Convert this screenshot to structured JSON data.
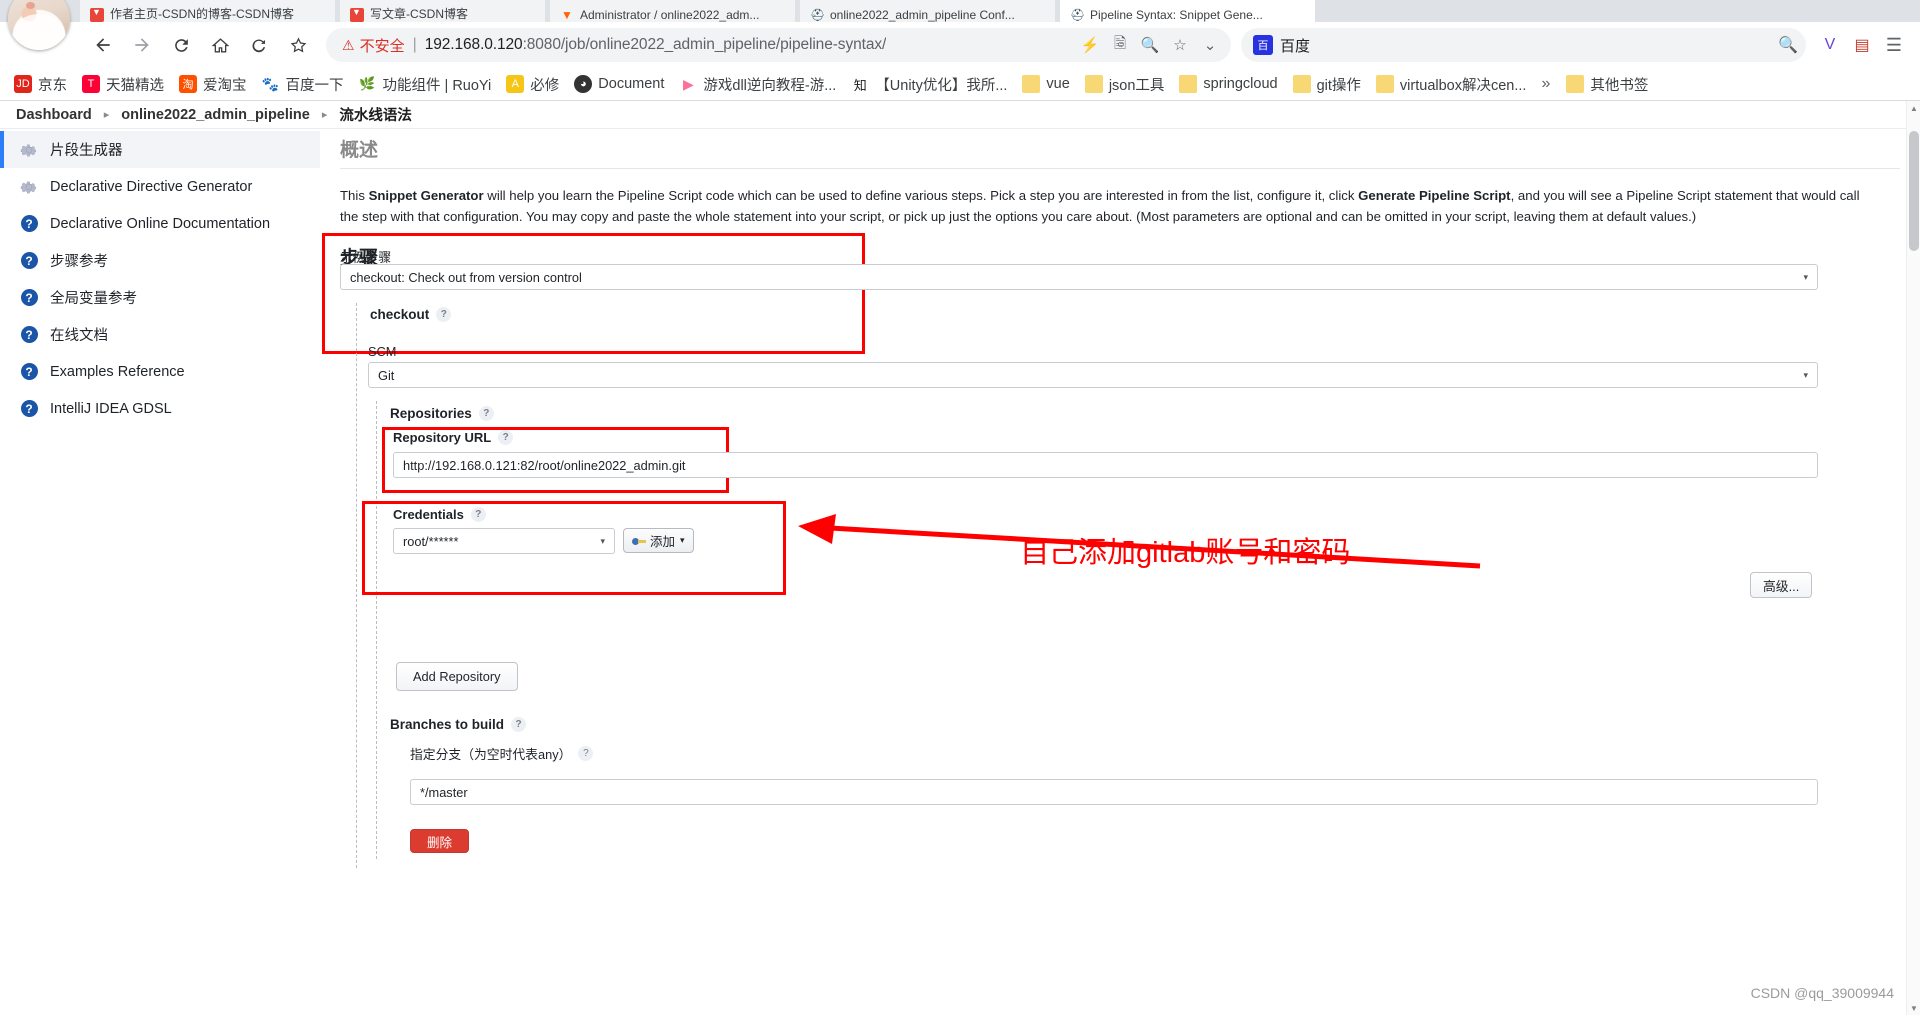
{
  "browser": {
    "tabs": [
      {
        "label": "作者主页-CSDN的博客-CSDN博客",
        "favicon": "csdn-icon",
        "active": false
      },
      {
        "label": "写文章-CSDN博客",
        "favicon": "csdn-icon",
        "active": false
      },
      {
        "label": "Administrator / online2022_adm...",
        "favicon": "gitlab-icon",
        "active": false
      },
      {
        "label": "online2022_admin_pipeline Conf...",
        "favicon": "jenkins-icon",
        "active": false
      },
      {
        "label": "Pipeline Syntax: Snippet Gene...",
        "favicon": "jenkins-icon",
        "active": true
      }
    ],
    "nav": {
      "back_icon": "back-arrow-icon",
      "forward_icon": "forward-arrow-icon",
      "reload_icon": "reload-icon",
      "home_icon": "home-icon",
      "history_icon": "history-back-icon",
      "bookmark_icon": "star-icon"
    },
    "omnibox": {
      "security_label": "不安全",
      "security_icon": "warning-triangle-icon",
      "url_host": "192.168.0.120",
      "url_path": ":8080/job/online2022_admin_pipeline/pipeline-syntax/",
      "icons": [
        "lightning-icon",
        "translate-icon",
        "zoom-icon",
        "star-outline-icon",
        "chevron-down-icon"
      ]
    },
    "search": {
      "engine_label": "百度",
      "engine_icon": "baidu-icon",
      "search_icon": "search-icon"
    },
    "right_icons": [
      "v-extension-icon",
      "pdf-extension-icon",
      "menu-icon"
    ],
    "bookmarks": [
      {
        "label": "京东",
        "icon": "jd-icon",
        "color": "#e1251b"
      },
      {
        "label": "天猫精选",
        "icon": "tmall-icon",
        "color": "#ff0036"
      },
      {
        "label": "爱淘宝",
        "icon": "taobao-icon",
        "color": "#ff5000"
      },
      {
        "label": "百度一下",
        "icon": "baidu-icon",
        "color": "#2932e1"
      },
      {
        "label": "功能组件 | RuoYi",
        "icon": "ruoyi-icon",
        "color": "#6ab04c"
      },
      {
        "label": "必修",
        "icon": "bixiu-icon",
        "color": "#f5c518"
      },
      {
        "label": "Document",
        "icon": "document-icon",
        "color": "#333333"
      },
      {
        "label": "游戏dll逆向教程-游...",
        "icon": "bilibili-icon",
        "color": "#fb7299"
      },
      {
        "label": "【Unity优化】我所...",
        "icon": "zhihu-icon",
        "color": "#0084ff"
      },
      {
        "label": "vue",
        "icon": "folder-icon",
        "color": "#f8d775"
      },
      {
        "label": "json工具",
        "icon": "folder-icon",
        "color": "#f8d775"
      },
      {
        "label": "springcloud",
        "icon": "folder-icon",
        "color": "#f8d775"
      },
      {
        "label": "git操作",
        "icon": "folder-icon",
        "color": "#f8d775"
      },
      {
        "label": "virtualbox解决cen...",
        "icon": "folder-icon",
        "color": "#f8d775"
      }
    ],
    "bookmarks_overflow": "»",
    "other_bookmarks": {
      "label": "其他书签",
      "icon": "folder-icon"
    }
  },
  "jenkins": {
    "breadcrumb": [
      {
        "label": "Dashboard"
      },
      {
        "label": "online2022_admin_pipeline"
      },
      {
        "label": "流水线语法"
      }
    ],
    "breadcrumb_separator": "▸",
    "sidebar": [
      {
        "label": "片段生成器",
        "icon": "gear-icon",
        "active": true
      },
      {
        "label": "Declarative Directive Generator",
        "icon": "gear-icon",
        "active": false
      },
      {
        "label": "Declarative Online Documentation",
        "icon": "help-icon",
        "active": false
      },
      {
        "label": "步骤参考",
        "icon": "help-icon",
        "active": false
      },
      {
        "label": "全局变量参考",
        "icon": "help-icon",
        "active": false
      },
      {
        "label": "在线文档",
        "icon": "help-icon",
        "active": false
      },
      {
        "label": "Examples Reference",
        "icon": "help-icon",
        "active": false
      },
      {
        "label": "IntelliJ IDEA GDSL",
        "icon": "help-icon",
        "active": false
      }
    ],
    "page_title": "概述",
    "intro": {
      "l1_a": "This ",
      "l1_b": "Snippet Generator",
      "l1_c": " will help you learn the Pipeline Script code which can be used to define various steps. Pick a step you are interested in from the list, configure it, click ",
      "l1_d": "Generate Pipeline Script",
      "l1_e": ", and you will see a Pipeline Script statement that would call",
      "l2": "the step with that configuration. You may copy and paste the whole statement into your script, or pick up just the options you care about. (Most parameters are optional and can be omitted in your script, leaving them at default values.)"
    },
    "steps_heading": "步骤",
    "sample_step": {
      "label": "示例步骤",
      "value": "checkout: Check out from version control",
      "caret": "▾"
    },
    "checkout": {
      "label": "checkout",
      "help": "?"
    },
    "scm": {
      "label": "SCM",
      "value": "Git",
      "caret": "▾"
    },
    "repositories": {
      "label": "Repositories",
      "help": "?"
    },
    "repository_url": {
      "label": "Repository URL",
      "help": "?",
      "value": "http://192.168.0.121:82/root/online2022_admin.git"
    },
    "credentials": {
      "label": "Credentials",
      "help": "?",
      "value": "root/******",
      "caret": "▾",
      "add_button": "添加",
      "add_caret": "▾",
      "add_icon": "key-icon"
    },
    "advanced_button": "高级...",
    "add_repository_button": "Add Repository",
    "branches": {
      "label": "Branches to build",
      "help": "?",
      "field_label": "指定分支（为空时代表any）",
      "field_help": "?",
      "value": "*/master"
    },
    "delete_button": "删除"
  },
  "annotation": {
    "text": "自己添加gitlab账号和密码",
    "color": "#fe0000",
    "arrow": "left-arrow-icon"
  },
  "watermark": "CSDN @qq_39009944",
  "colors": {
    "annotation_red": "#fe0000",
    "highlight_box": "#ff0000",
    "accent_blue": "#2d7ff9",
    "danger": "#dc3c30"
  }
}
